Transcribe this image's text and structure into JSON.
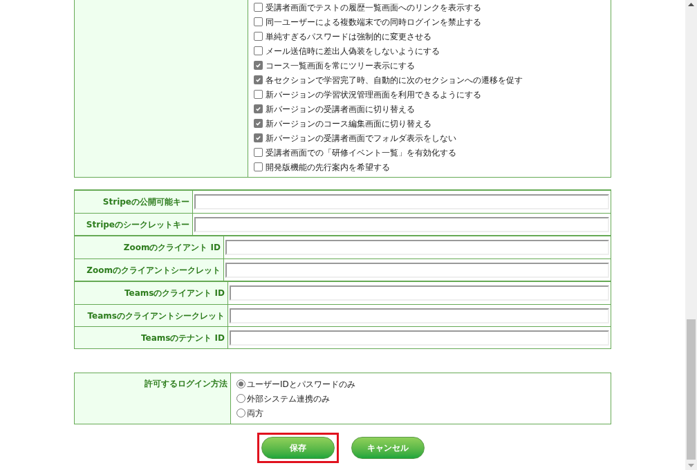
{
  "options": [
    {
      "label": "受講者画面でテストの履歴一覧画面へのリンクを表示する",
      "checked": false
    },
    {
      "label": "同一ユーザーによる複数端末での同時ログインを禁止する",
      "checked": false
    },
    {
      "label": "単純すぎるパスワードは強制的に変更させる",
      "checked": false
    },
    {
      "label": "メール送信時に差出人偽装をしないようにする",
      "checked": false
    },
    {
      "label": "コース一覧画面を常にツリー表示にする",
      "checked": true
    },
    {
      "label": "各セクションで学習完了時、自動的に次のセクションへの遷移を促す",
      "checked": true
    },
    {
      "label": "新バージョンの学習状況管理画面を利用できるようにする",
      "checked": false
    },
    {
      "label": "新バージョンの受講者画面に切り替える",
      "checked": true
    },
    {
      "label": "新バージョンのコース編集画面に切り替える",
      "checked": true
    },
    {
      "label": "新バージョンの受講者画面でフォルダ表示をしない",
      "checked": true
    },
    {
      "label": "受講者画面での「研修イベント一覧」を有効化する",
      "checked": false
    },
    {
      "label": "開発版機能の先行案内を希望する",
      "checked": false
    }
  ],
  "field_groups": [
    {
      "fields": [
        {
          "label": "Stripeの公開可能キー"
        },
        {
          "label": "Stripeのシークレットキー"
        }
      ]
    },
    {
      "fields": [
        {
          "label": "Zoomのクライアント ID"
        },
        {
          "label": "Zoomのクライアントシークレット"
        }
      ]
    },
    {
      "fields": [
        {
          "label": "Teamsのクライアント ID"
        },
        {
          "label": "Teamsのクライアントシークレット"
        },
        {
          "label": "Teamsのテナント ID"
        }
      ]
    }
  ],
  "login": {
    "label": "許可するログイン方法",
    "choices": [
      {
        "label": "ユーザーIDとパスワードのみ",
        "selected": true
      },
      {
        "label": "外部システム連携のみ",
        "selected": false
      },
      {
        "label": "両方",
        "selected": false
      }
    ]
  },
  "buttons": [
    {
      "label": "保存",
      "highlighted": true
    },
    {
      "label": "キャンセル",
      "highlighted": false
    }
  ]
}
